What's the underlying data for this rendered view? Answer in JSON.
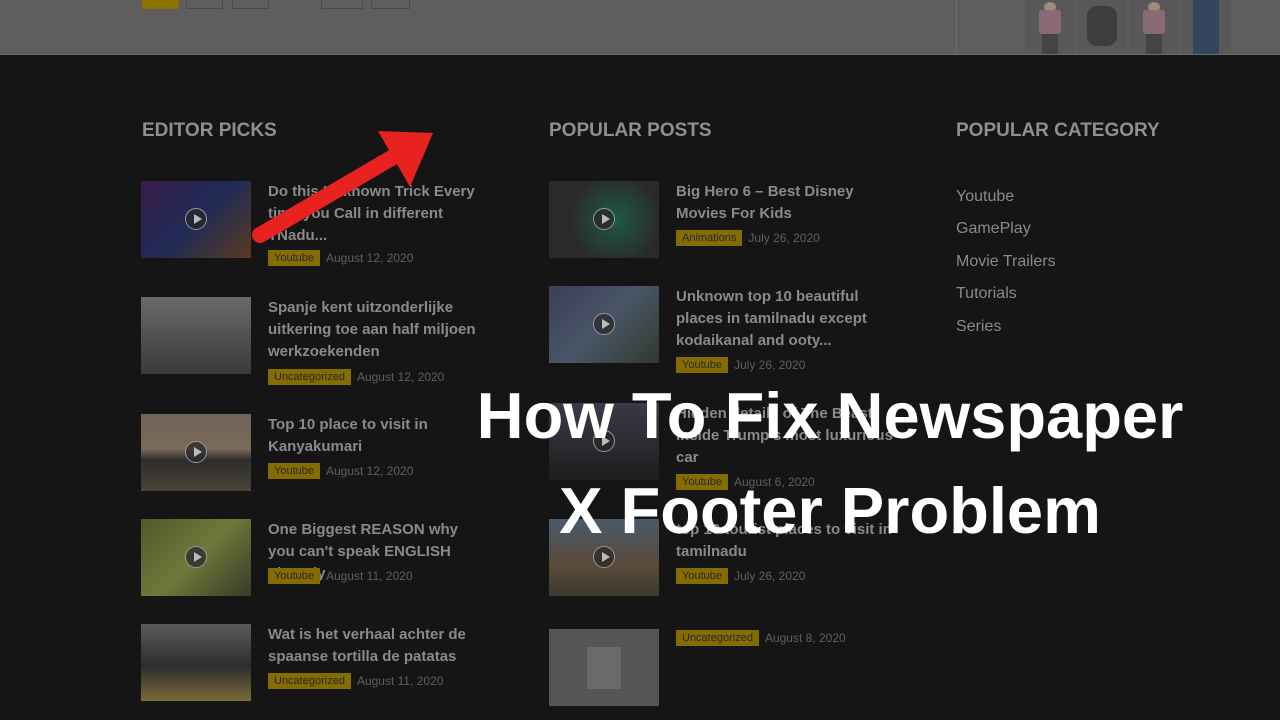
{
  "top_pagination": {
    "active_page": 1
  },
  "editor_picks": {
    "title": "EDITOR PICKS",
    "posts": [
      {
        "title": "Do this Unknown Trick Every time you Call in different TNadu...",
        "category": "Youtube",
        "date": "August 12, 2020"
      },
      {
        "title": "Spanje kent uitzonderlijke uitkering toe aan half miljoen werkzoekenden",
        "category": "Uncategorized",
        "date": "August 12, 2020"
      },
      {
        "title": "Top 10 place to visit in Kanyakumari",
        "category": "Youtube",
        "date": "August 12, 2020"
      },
      {
        "title": "One Biggest REASON why you can't speak ENGLISH Fluently",
        "category": "Youtube",
        "date": "August 11, 2020"
      },
      {
        "title": "Wat is het verhaal achter de spaanse tortilla de patatas",
        "category": "Uncategorized",
        "date": "August 11, 2020"
      }
    ]
  },
  "popular_posts": {
    "title": "POPULAR POSTS",
    "posts": [
      {
        "title": "Big Hero 6 – Best Disney Movies For Kids",
        "category": "Animations",
        "date": "July 26, 2020"
      },
      {
        "title": "Unknown top 10 beautiful places in tamilnadu except kodaikanal and ooty...",
        "category": "Youtube",
        "date": "July 26, 2020"
      },
      {
        "title": "Hidden details of The Beast Inside Trump's most luxurious car",
        "category": "Youtube",
        "date": "August 6, 2020"
      },
      {
        "title": "top 10 tourist places to visit in tamilnadu",
        "category": "Youtube",
        "date": "July 26, 2020"
      },
      {
        "title": "",
        "category": "Uncategorized",
        "date": "August 8, 2020"
      }
    ]
  },
  "popular_category": {
    "title": "POPULAR CATEGORY",
    "items": [
      "Youtube",
      "GamePlay",
      "Movie Trailers",
      "Tutorials",
      "Series"
    ]
  },
  "overlay": {
    "headline_line1": "How To Fix Newspaper",
    "headline_line2": "X Footer Problem",
    "arrow_color": "#e8231f"
  },
  "colors": {
    "accent": "#846c00",
    "footer_bg": "#151515",
    "headline": "#ffffff"
  }
}
